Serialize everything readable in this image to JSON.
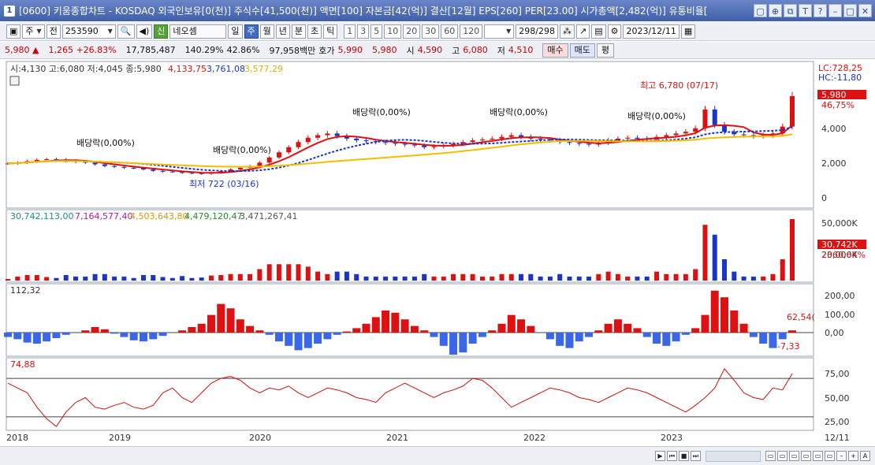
{
  "title": "[0600] 키움종합차트 - KOSDAQ 외국인보유[0(천)] 주식수[41,500(천)] 액면[100] 자본금[42(억)] 결산[12월] EPS[260] PER[23.00] 시가총액[2,482(억)] 유통비율[",
  "sys_icon": "1",
  "toolbar": {
    "period_type": "주",
    "prev_label": "전",
    "code": "253590",
    "stock_badge": "신",
    "stock_name": "네오셈",
    "timeframes": [
      "일",
      "주",
      "월",
      "년",
      "분",
      "초",
      "틱"
    ],
    "selected_timeframe": "주",
    "minute_options": [
      "1",
      "3",
      "5",
      "10",
      "20",
      "30",
      "60",
      "120"
    ],
    "count": "298",
    "count_total": "/298",
    "date": "2023/12/11"
  },
  "quote": {
    "price": "5,980",
    "change": "1,265",
    "change_rate": "+26.83%",
    "volume": "17,785,487",
    "vol_rate": "140.29%",
    "turnover": "42.86%",
    "amount": "97,958백만",
    "bid_label": "호가",
    "ask": "5,990",
    "bid": "5,980",
    "open_label": "시",
    "open": "4,590",
    "high_label": "고",
    "high": "6,080",
    "low_label": "저",
    "low": "4,510",
    "buy_label": "매수",
    "sell_label": "매도",
    "eval_label": "평"
  },
  "chart_data": [
    {
      "type": "candlestick",
      "legend": "시:4,130 고:6,080 저:4,045 종:5,980",
      "ma_values": [
        "4,133,75",
        "3,761,08",
        "3,577,29"
      ],
      "colors": {
        "up": "#dd1111",
        "down": "#1a35c8",
        "ma1": "#dd1111",
        "ma2": "#1a35c8",
        "ma3": "#f0c000"
      },
      "y_ticks": [
        "4,000",
        "2,000",
        "0"
      ],
      "right_labels": {
        "lc": "LC:728,25",
        "hc": "HC:-11,80",
        "last": "5,980",
        "pct": "46,75%"
      },
      "annotations": [
        "배당락(0,00%)",
        "배당락(0,00%)",
        "배당락(0,00%)",
        "배당락(0,00%)",
        "배당락(0,00%)"
      ],
      "max_label": "최고 6,780 (07/17)",
      "min_label": "최저 722 (03/16)",
      "close_series": [
        2050,
        2100,
        2180,
        2260,
        2300,
        2280,
        2200,
        2150,
        2100,
        2000,
        1900,
        1850,
        1800,
        1780,
        1700,
        1620,
        1580,
        1560,
        1500,
        1480,
        1450,
        1520,
        1600,
        1700,
        1800,
        1900,
        2100,
        2400,
        2700,
        3000,
        3300,
        3550,
        3700,
        3800,
        3650,
        3500,
        3400,
        3350,
        3300,
        3250,
        3200,
        3150,
        3100,
        3000,
        3050,
        3100,
        3200,
        3300,
        3400,
        3450,
        3500,
        3600,
        3700,
        3600,
        3500,
        3450,
        3400,
        3300,
        3250,
        3200,
        3150,
        3250,
        3400,
        3500,
        3550,
        3500,
        3450,
        3600,
        3700,
        3800,
        3900,
        4100,
        5200,
        4300,
        3900,
        3750,
        3700,
        3650,
        3700,
        3800,
        4200,
        5980
      ]
    },
    {
      "type": "bar",
      "legend": [
        "30,742,113,00",
        "7,164,577,40",
        "4,503,643,80",
        "4,479,120,47",
        "3,471,267,41"
      ],
      "y_ticks": [
        "50,000K",
        "20,000K"
      ],
      "right_labels": {
        "last": "30,742K",
        "pct": "2360,64%"
      }
    },
    {
      "type": "bar",
      "legend": "112,32",
      "y_ticks": [
        "200,00",
        "100,00",
        "0,00"
      ],
      "right_labels": {
        "peak": "62,54(",
        "low": "-7,33"
      },
      "values": [
        -20,
        -30,
        -45,
        -50,
        -40,
        -25,
        -10,
        0,
        10,
        25,
        15,
        -5,
        -20,
        -35,
        -40,
        -30,
        -15,
        0,
        10,
        25,
        40,
        80,
        130,
        110,
        60,
        30,
        10,
        -10,
        -40,
        -60,
        -80,
        -70,
        -50,
        -30,
        -10,
        5,
        20,
        40,
        70,
        100,
        90,
        60,
        30,
        10,
        -20,
        -60,
        -100,
        -90,
        -50,
        -20,
        10,
        40,
        80,
        60,
        30,
        0,
        -30,
        -60,
        -70,
        -40,
        -20,
        10,
        40,
        60,
        40,
        20,
        -20,
        -50,
        -60,
        -40,
        -10,
        20,
        80,
        190,
        160,
        100,
        40,
        -20,
        -50,
        -70,
        -30,
        10
      ]
    },
    {
      "type": "line",
      "legend": "74,88",
      "y_ticks": [
        "75,00",
        "50,00",
        "25,00"
      ],
      "values": [
        65,
        60,
        55,
        40,
        28,
        20,
        35,
        45,
        50,
        40,
        38,
        42,
        45,
        40,
        38,
        42,
        55,
        60,
        50,
        45,
        55,
        65,
        70,
        72,
        68,
        60,
        55,
        60,
        58,
        62,
        55,
        50,
        55,
        60,
        58,
        55,
        50,
        48,
        45,
        55,
        60,
        65,
        60,
        55,
        50,
        55,
        58,
        62,
        70,
        68,
        60,
        50,
        40,
        45,
        50,
        55,
        60,
        58,
        55,
        50,
        48,
        45,
        50,
        55,
        60,
        58,
        55,
        50,
        45,
        40,
        35,
        42,
        50,
        60,
        80,
        68,
        55,
        50,
        48,
        60,
        58,
        75
      ]
    }
  ],
  "x_axis": [
    "2018",
    "2019",
    "2020",
    "2021",
    "2022",
    "2023",
    "12/11"
  ]
}
